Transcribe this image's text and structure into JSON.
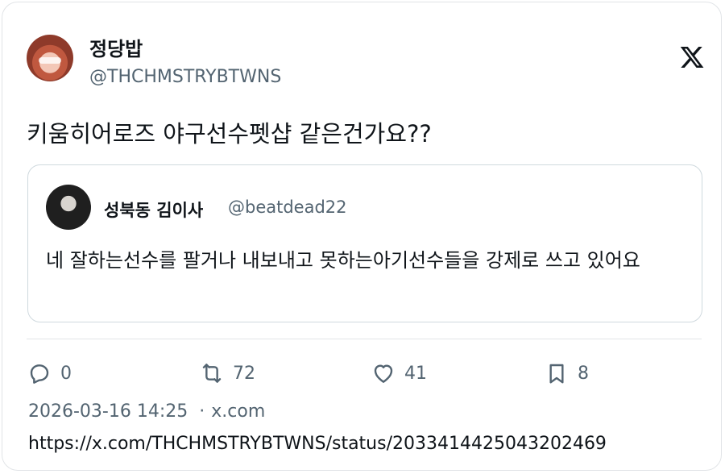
{
  "tweet": {
    "author": {
      "name": "정당밥",
      "handle": "@THCHMSTRYBTWNS"
    },
    "text": "키움히어로즈 야구선수펫샵 같은건가요??",
    "quoted": {
      "author": {
        "name": "성북동 김이사",
        "handle": "@beatdead22"
      },
      "text": "네 잘하는선수를 팔거나 내보내고 못하는아기선수들을 강제로 쓰고 있어요"
    },
    "stats": {
      "replies": "0",
      "retweets": "72",
      "likes": "41",
      "bookmarks": "8"
    },
    "timestamp": "2026-03-16 14:25",
    "source": "x.com",
    "url": "https://x.com/THCHMSTRYBTWNS/status/2033414425043202469"
  },
  "icons": {
    "logo": "x-logo-icon",
    "reply": "reply-icon",
    "retweet": "retweet-icon",
    "like": "heart-icon",
    "bookmark": "bookmark-icon"
  },
  "colors": {
    "text": "#0f1419",
    "muted": "#536471",
    "border": "#cfd9de"
  }
}
